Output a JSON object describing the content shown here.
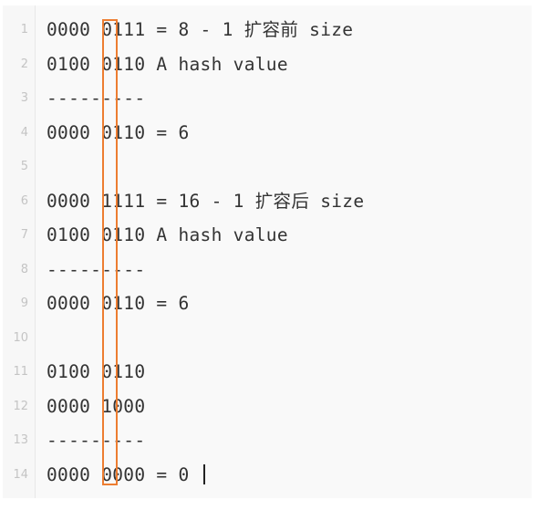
{
  "editor": {
    "lines": [
      {
        "number": "1",
        "text": "0000 0111 = 8 - 1 扩容前 size"
      },
      {
        "number": "2",
        "text": "0100 0110 A hash value"
      },
      {
        "number": "3",
        "text": "---------"
      },
      {
        "number": "4",
        "text": "0000 0110 = 6"
      },
      {
        "number": "5",
        "text": ""
      },
      {
        "number": "6",
        "text": "0000 1111 = 16 - 1 扩容后 size"
      },
      {
        "number": "7",
        "text": "0100 0110 A hash value"
      },
      {
        "number": "8",
        "text": "---------"
      },
      {
        "number": "9",
        "text": "0000 0110 = 6"
      },
      {
        "number": "10",
        "text": ""
      },
      {
        "number": "11",
        "text": "0100 0110"
      },
      {
        "number": "12",
        "text": "0000 1000"
      },
      {
        "number": "13",
        "text": "---------"
      },
      {
        "number": "14",
        "text": "0000 0000 = 0"
      }
    ]
  },
  "colors": {
    "highlight_box": "#ed7d31",
    "line_number": "#c4c4c4",
    "code_text": "#333333"
  }
}
